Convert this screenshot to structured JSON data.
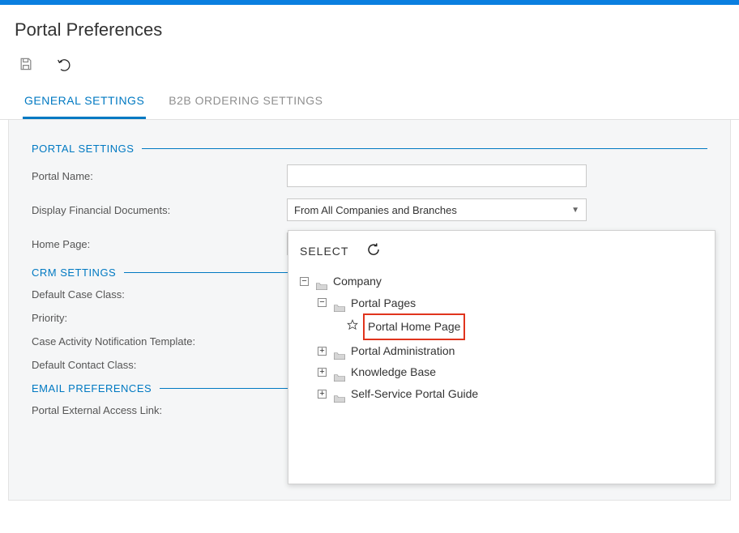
{
  "page_title": "Portal Preferences",
  "tabs": [
    {
      "label": "GENERAL SETTINGS",
      "active": true
    },
    {
      "label": "B2B ORDERING SETTINGS",
      "active": false
    }
  ],
  "sections": {
    "portal_settings": {
      "title": "PORTAL SETTINGS",
      "portal_name_label": "Portal Name:",
      "portal_name_value": "",
      "display_docs_label": "Display Financial Documents:",
      "display_docs_value": "From All Companies and Branches",
      "home_page_label": "Home Page:",
      "home_page_value": ""
    },
    "crm_settings": {
      "title": "CRM SETTINGS",
      "default_case_class": "Default Case Class:",
      "priority": "Priority:",
      "notification_template": "Case Activity Notification Template:",
      "default_contact_class": "Default Contact Class:"
    },
    "email_preferences": {
      "title": "EMAIL PREFERENCES",
      "external_link": "Portal External Access Link:"
    }
  },
  "tree_panel": {
    "select_label": "SELECT",
    "nodes": {
      "root": "Company",
      "portal_pages": "Portal Pages",
      "portal_home": "Portal Home Page",
      "portal_admin": "Portal Administration",
      "knowledge_base": "Knowledge Base",
      "self_service": "Self-Service Portal Guide"
    }
  }
}
